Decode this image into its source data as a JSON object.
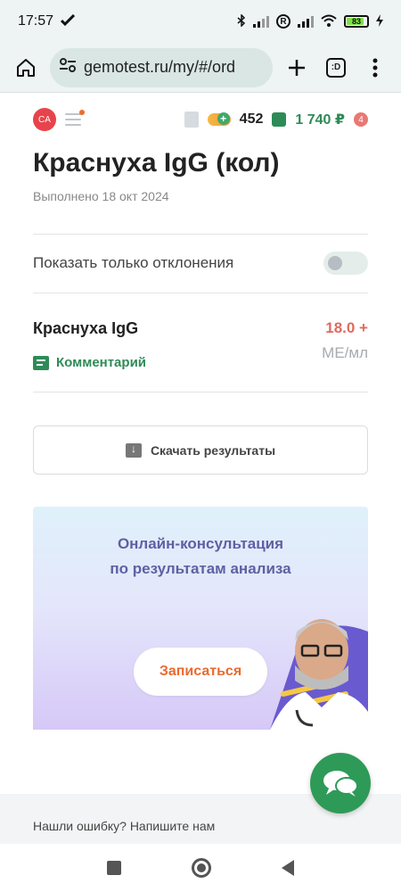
{
  "status_bar": {
    "time": "17:57",
    "battery": "83"
  },
  "browser": {
    "url": "gemotest.ru/my/#/ord",
    "tabs_label": ":D"
  },
  "header": {
    "avatar_initials": "CA",
    "bonus_count": "452",
    "cart_sum": "1 740 ₽",
    "cart_badge": "4"
  },
  "page": {
    "title": "Краснуха IgG (кол)",
    "subtitle": "Выполнено 18 окт 2024"
  },
  "filter": {
    "label": "Показать только отклонения"
  },
  "result": {
    "name": "Краснуха IgG",
    "value": "18.0 +",
    "unit": "МЕ/мл",
    "comment_label": "Комментарий"
  },
  "download": {
    "label": "Скачать результаты"
  },
  "banner": {
    "line1": "Онлайн-консультация",
    "line2": "по результатам анализа",
    "button_label": "Записаться"
  },
  "footer": {
    "text": "Нашли ошибку? Напишите нам"
  },
  "colors": {
    "accent_green": "#2e8b57",
    "value_red": "#e06a5f",
    "banner_text": "#5f5fa3",
    "cta_orange": "#ea6a2f"
  }
}
